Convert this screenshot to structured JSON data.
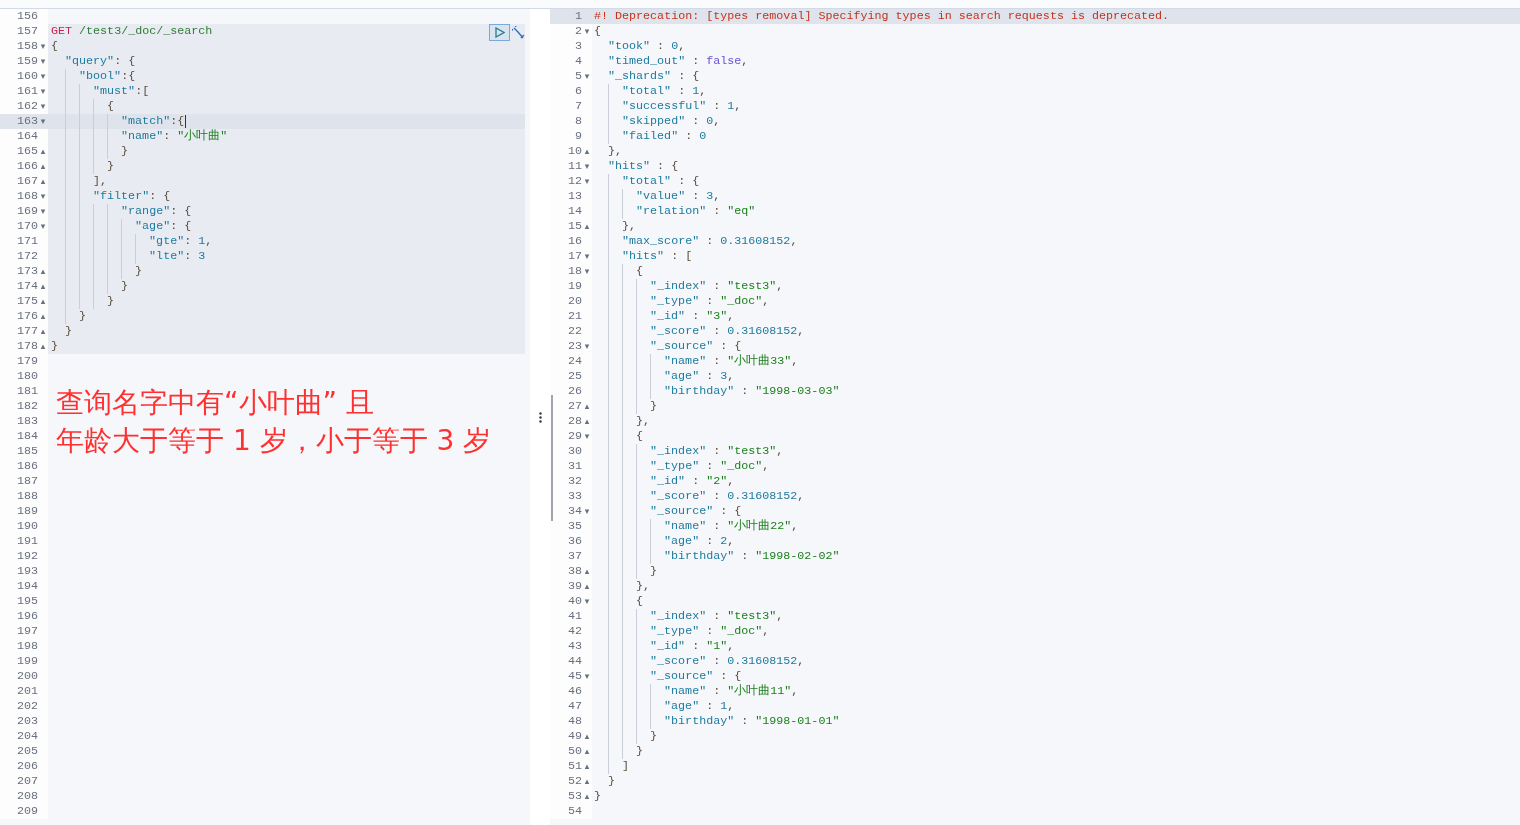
{
  "request_editor": {
    "lines_before": [
      {
        "number": "156",
        "current": false
      }
    ],
    "request": {
      "lines": [
        {
          "number": "157",
          "current": false,
          "tokens": [
            {
              "kind": "method",
              "text": "GET"
            },
            {
              "kind": "path",
              "text": " /test3/_doc/_search"
            }
          ]
        },
        {
          "number": "158",
          "fold": "▾",
          "current": false,
          "tokens": [
            {
              "kind": "punct",
              "text": "{"
            }
          ]
        },
        {
          "number": "159",
          "fold": "▾",
          "current": false,
          "tokens": [
            {
              "kind": "key",
              "text": "  \"query\""
            },
            {
              "kind": "punct",
              "text": ": {"
            }
          ]
        },
        {
          "number": "160",
          "fold": "▾",
          "current": false,
          "tokens": [
            {
              "kind": "key",
              "text": "    \"bool\""
            },
            {
              "kind": "punct",
              "text": ":{"
            }
          ]
        },
        {
          "number": "161",
          "fold": "▾",
          "current": false,
          "tokens": [
            {
              "kind": "key",
              "text": "      \"must\""
            },
            {
              "kind": "punct",
              "text": ":["
            }
          ]
        },
        {
          "number": "162",
          "fold": "▾",
          "current": false,
          "tokens": [
            {
              "kind": "punct",
              "text": "        {"
            }
          ]
        },
        {
          "number": "163",
          "fold": "▾",
          "current": true,
          "cursor": true,
          "tokens": [
            {
              "kind": "key",
              "text": "          \"match\""
            },
            {
              "kind": "punct",
              "text": ":{"
            }
          ]
        },
        {
          "number": "164",
          "current": false,
          "tokens": [
            {
              "kind": "key",
              "text": "          \"name\""
            },
            {
              "kind": "punct",
              "text": ": "
            },
            {
              "kind": "string",
              "text": "\"小叶曲\""
            }
          ]
        },
        {
          "number": "165",
          "fold": "▴",
          "current": false,
          "tokens": [
            {
              "kind": "punct",
              "text": "          }"
            }
          ]
        },
        {
          "number": "166",
          "fold": "▴",
          "current": false,
          "tokens": [
            {
              "kind": "punct",
              "text": "        }"
            }
          ]
        },
        {
          "number": "167",
          "fold": "▴",
          "current": false,
          "tokens": [
            {
              "kind": "punct",
              "text": "      ],"
            }
          ]
        },
        {
          "number": "168",
          "fold": "▾",
          "current": false,
          "tokens": [
            {
              "kind": "key",
              "text": "      \"filter\""
            },
            {
              "kind": "punct",
              "text": ": {"
            }
          ]
        },
        {
          "number": "169",
          "fold": "▾",
          "current": false,
          "tokens": [
            {
              "kind": "key",
              "text": "          \"range\""
            },
            {
              "kind": "punct",
              "text": ": {"
            }
          ]
        },
        {
          "number": "170",
          "fold": "▾",
          "current": false,
          "tokens": [
            {
              "kind": "key",
              "text": "            \"age\""
            },
            {
              "kind": "punct",
              "text": ": {"
            }
          ]
        },
        {
          "number": "171",
          "current": false,
          "tokens": [
            {
              "kind": "key",
              "text": "              \"gte\""
            },
            {
              "kind": "punct",
              "text": ": "
            },
            {
              "kind": "number",
              "text": "1"
            },
            {
              "kind": "punct",
              "text": ","
            }
          ]
        },
        {
          "number": "172",
          "current": false,
          "tokens": [
            {
              "kind": "key",
              "text": "              \"lte\""
            },
            {
              "kind": "punct",
              "text": ": "
            },
            {
              "kind": "number",
              "text": "3"
            }
          ]
        },
        {
          "number": "173",
          "fold": "▴",
          "current": false,
          "tokens": [
            {
              "kind": "punct",
              "text": "            }"
            }
          ]
        },
        {
          "number": "174",
          "fold": "▴",
          "current": false,
          "tokens": [
            {
              "kind": "punct",
              "text": "          }"
            }
          ]
        },
        {
          "number": "175",
          "fold": "▴",
          "current": false,
          "tokens": [
            {
              "kind": "punct",
              "text": "        }"
            }
          ]
        },
        {
          "number": "176",
          "fold": "▴",
          "current": false,
          "tokens": [
            {
              "kind": "punct",
              "text": "    }"
            }
          ]
        },
        {
          "number": "177",
          "fold": "▴",
          "current": false,
          "tokens": [
            {
              "kind": "punct",
              "text": "  }"
            }
          ]
        },
        {
          "number": "178",
          "fold": "▴",
          "current": false,
          "tokens": [
            {
              "kind": "punct",
              "text": "}"
            }
          ]
        }
      ]
    },
    "lines_after": [
      {
        "number": "179",
        "current": false
      },
      {
        "number": "180",
        "current": false
      },
      {
        "number": "181",
        "current": false
      },
      {
        "number": "182",
        "current": false
      },
      {
        "number": "183",
        "current": false
      },
      {
        "number": "184",
        "current": false
      },
      {
        "number": "185",
        "current": false
      },
      {
        "number": "186",
        "current": false
      },
      {
        "number": "187",
        "current": false
      },
      {
        "number": "188",
        "current": false
      },
      {
        "number": "189",
        "current": false
      },
      {
        "number": "190",
        "current": false
      },
      {
        "number": "191",
        "current": false
      },
      {
        "number": "192",
        "current": false
      },
      {
        "number": "193",
        "current": false
      },
      {
        "number": "194",
        "current": false
      },
      {
        "number": "195",
        "current": false
      },
      {
        "number": "196",
        "current": false
      },
      {
        "number": "197",
        "current": false
      },
      {
        "number": "198",
        "current": false
      },
      {
        "number": "199",
        "current": false
      },
      {
        "number": "200",
        "current": false
      },
      {
        "number": "201",
        "current": false
      },
      {
        "number": "202",
        "current": false
      },
      {
        "number": "203",
        "current": false
      },
      {
        "number": "204",
        "current": false
      },
      {
        "number": "205",
        "current": false
      },
      {
        "number": "206",
        "current": false
      },
      {
        "number": "207",
        "current": false
      },
      {
        "number": "208",
        "current": false
      },
      {
        "number": "209",
        "current": false
      }
    ],
    "annotation": [
      "查询名字中有“小叶曲” 且",
      "年龄大于等于 1 岁，小于等于 3 岁"
    ]
  },
  "response_editor": {
    "lines": [
      {
        "number": "1",
        "current": true,
        "tokens": [
          {
            "kind": "comment",
            "text": "#! Deprecation: [types removal] Specifying types in search requests is deprecated."
          }
        ]
      },
      {
        "number": "2",
        "fold": "▾",
        "current": false,
        "tokens": [
          {
            "kind": "punct",
            "text": "{"
          }
        ]
      },
      {
        "number": "3",
        "current": false,
        "tokens": [
          {
            "kind": "key",
            "text": "  \"took\""
          },
          {
            "kind": "punct",
            "text": " : "
          },
          {
            "kind": "number",
            "text": "0"
          },
          {
            "kind": "punct",
            "text": ","
          }
        ]
      },
      {
        "number": "4",
        "current": false,
        "tokens": [
          {
            "kind": "key",
            "text": "  \"timed_out\""
          },
          {
            "kind": "punct",
            "text": " : "
          },
          {
            "kind": "bool",
            "text": "false"
          },
          {
            "kind": "punct",
            "text": ","
          }
        ]
      },
      {
        "number": "5",
        "fold": "▾",
        "current": false,
        "tokens": [
          {
            "kind": "key",
            "text": "  \"_shards\""
          },
          {
            "kind": "punct",
            "text": " : {"
          }
        ]
      },
      {
        "number": "6",
        "current": false,
        "tokens": [
          {
            "kind": "key",
            "text": "    \"total\""
          },
          {
            "kind": "punct",
            "text": " : "
          },
          {
            "kind": "number",
            "text": "1"
          },
          {
            "kind": "punct",
            "text": ","
          }
        ]
      },
      {
        "number": "7",
        "current": false,
        "tokens": [
          {
            "kind": "key",
            "text": "    \"successful\""
          },
          {
            "kind": "punct",
            "text": " : "
          },
          {
            "kind": "number",
            "text": "1"
          },
          {
            "kind": "punct",
            "text": ","
          }
        ]
      },
      {
        "number": "8",
        "current": false,
        "tokens": [
          {
            "kind": "key",
            "text": "    \"skipped\""
          },
          {
            "kind": "punct",
            "text": " : "
          },
          {
            "kind": "number",
            "text": "0"
          },
          {
            "kind": "punct",
            "text": ","
          }
        ]
      },
      {
        "number": "9",
        "current": false,
        "tokens": [
          {
            "kind": "key",
            "text": "    \"failed\""
          },
          {
            "kind": "punct",
            "text": " : "
          },
          {
            "kind": "number",
            "text": "0"
          }
        ]
      },
      {
        "number": "10",
        "fold": "▴",
        "current": false,
        "tokens": [
          {
            "kind": "punct",
            "text": "  },"
          }
        ]
      },
      {
        "number": "11",
        "fold": "▾",
        "current": false,
        "tokens": [
          {
            "kind": "key",
            "text": "  \"hits\""
          },
          {
            "kind": "punct",
            "text": " : {"
          }
        ]
      },
      {
        "number": "12",
        "fold": "▾",
        "current": false,
        "tokens": [
          {
            "kind": "key",
            "text": "    \"total\""
          },
          {
            "kind": "punct",
            "text": " : {"
          }
        ]
      },
      {
        "number": "13",
        "current": false,
        "tokens": [
          {
            "kind": "key",
            "text": "      \"value\""
          },
          {
            "kind": "punct",
            "text": " : "
          },
          {
            "kind": "number",
            "text": "3"
          },
          {
            "kind": "punct",
            "text": ","
          }
        ]
      },
      {
        "number": "14",
        "current": false,
        "tokens": [
          {
            "kind": "key",
            "text": "      \"relation\""
          },
          {
            "kind": "punct",
            "text": " : "
          },
          {
            "kind": "string",
            "text": "\"eq\""
          }
        ]
      },
      {
        "number": "15",
        "fold": "▴",
        "current": false,
        "tokens": [
          {
            "kind": "punct",
            "text": "    },"
          }
        ]
      },
      {
        "number": "16",
        "current": false,
        "tokens": [
          {
            "kind": "key",
            "text": "    \"max_score\""
          },
          {
            "kind": "punct",
            "text": " : "
          },
          {
            "kind": "number",
            "text": "0.31608152"
          },
          {
            "kind": "punct",
            "text": ","
          }
        ]
      },
      {
        "number": "17",
        "fold": "▾",
        "current": false,
        "tokens": [
          {
            "kind": "key",
            "text": "    \"hits\""
          },
          {
            "kind": "punct",
            "text": " : ["
          }
        ]
      },
      {
        "number": "18",
        "fold": "▾",
        "current": false,
        "tokens": [
          {
            "kind": "punct",
            "text": "      {"
          }
        ]
      },
      {
        "number": "19",
        "current": false,
        "tokens": [
          {
            "kind": "key",
            "text": "        \"_index\""
          },
          {
            "kind": "punct",
            "text": " : "
          },
          {
            "kind": "string",
            "text": "\"test3\""
          },
          {
            "kind": "punct",
            "text": ","
          }
        ]
      },
      {
        "number": "20",
        "current": false,
        "tokens": [
          {
            "kind": "key",
            "text": "        \"_type\""
          },
          {
            "kind": "punct",
            "text": " : "
          },
          {
            "kind": "string",
            "text": "\"_doc\""
          },
          {
            "kind": "punct",
            "text": ","
          }
        ]
      },
      {
        "number": "21",
        "current": false,
        "tokens": [
          {
            "kind": "key",
            "text": "        \"_id\""
          },
          {
            "kind": "punct",
            "text": " : "
          },
          {
            "kind": "string",
            "text": "\"3\""
          },
          {
            "kind": "punct",
            "text": ","
          }
        ]
      },
      {
        "number": "22",
        "current": false,
        "tokens": [
          {
            "kind": "key",
            "text": "        \"_score\""
          },
          {
            "kind": "punct",
            "text": " : "
          },
          {
            "kind": "number",
            "text": "0.31608152"
          },
          {
            "kind": "punct",
            "text": ","
          }
        ]
      },
      {
        "number": "23",
        "fold": "▾",
        "current": false,
        "tokens": [
          {
            "kind": "key",
            "text": "        \"_source\""
          },
          {
            "kind": "punct",
            "text": " : {"
          }
        ]
      },
      {
        "number": "24",
        "current": false,
        "tokens": [
          {
            "kind": "key",
            "text": "          \"name\""
          },
          {
            "kind": "punct",
            "text": " : "
          },
          {
            "kind": "string",
            "text": "\"小叶曲33\""
          },
          {
            "kind": "punct",
            "text": ","
          }
        ]
      },
      {
        "number": "25",
        "current": false,
        "tokens": [
          {
            "kind": "key",
            "text": "          \"age\""
          },
          {
            "kind": "punct",
            "text": " : "
          },
          {
            "kind": "number",
            "text": "3"
          },
          {
            "kind": "punct",
            "text": ","
          }
        ]
      },
      {
        "number": "26",
        "current": false,
        "tokens": [
          {
            "kind": "key",
            "text": "          \"birthday\""
          },
          {
            "kind": "punct",
            "text": " : "
          },
          {
            "kind": "string",
            "text": "\"1998-03-03\""
          }
        ]
      },
      {
        "number": "27",
        "fold": "▴",
        "current": false,
        "tokens": [
          {
            "kind": "punct",
            "text": "        }"
          }
        ]
      },
      {
        "number": "28",
        "fold": "▴",
        "current": false,
        "tokens": [
          {
            "kind": "punct",
            "text": "      },"
          }
        ]
      },
      {
        "number": "29",
        "fold": "▾",
        "current": false,
        "tokens": [
          {
            "kind": "punct",
            "text": "      {"
          }
        ]
      },
      {
        "number": "30",
        "current": false,
        "tokens": [
          {
            "kind": "key",
            "text": "        \"_index\""
          },
          {
            "kind": "punct",
            "text": " : "
          },
          {
            "kind": "string",
            "text": "\"test3\""
          },
          {
            "kind": "punct",
            "text": ","
          }
        ]
      },
      {
        "number": "31",
        "current": false,
        "tokens": [
          {
            "kind": "key",
            "text": "        \"_type\""
          },
          {
            "kind": "punct",
            "text": " : "
          },
          {
            "kind": "string",
            "text": "\"_doc\""
          },
          {
            "kind": "punct",
            "text": ","
          }
        ]
      },
      {
        "number": "32",
        "current": false,
        "tokens": [
          {
            "kind": "key",
            "text": "        \"_id\""
          },
          {
            "kind": "punct",
            "text": " : "
          },
          {
            "kind": "string",
            "text": "\"2\""
          },
          {
            "kind": "punct",
            "text": ","
          }
        ]
      },
      {
        "number": "33",
        "current": false,
        "tokens": [
          {
            "kind": "key",
            "text": "        \"_score\""
          },
          {
            "kind": "punct",
            "text": " : "
          },
          {
            "kind": "number",
            "text": "0.31608152"
          },
          {
            "kind": "punct",
            "text": ","
          }
        ]
      },
      {
        "number": "34",
        "fold": "▾",
        "current": false,
        "tokens": [
          {
            "kind": "key",
            "text": "        \"_source\""
          },
          {
            "kind": "punct",
            "text": " : {"
          }
        ]
      },
      {
        "number": "35",
        "current": false,
        "tokens": [
          {
            "kind": "key",
            "text": "          \"name\""
          },
          {
            "kind": "punct",
            "text": " : "
          },
          {
            "kind": "string",
            "text": "\"小叶曲22\""
          },
          {
            "kind": "punct",
            "text": ","
          }
        ]
      },
      {
        "number": "36",
        "current": false,
        "tokens": [
          {
            "kind": "key",
            "text": "          \"age\""
          },
          {
            "kind": "punct",
            "text": " : "
          },
          {
            "kind": "number",
            "text": "2"
          },
          {
            "kind": "punct",
            "text": ","
          }
        ]
      },
      {
        "number": "37",
        "current": false,
        "tokens": [
          {
            "kind": "key",
            "text": "          \"birthday\""
          },
          {
            "kind": "punct",
            "text": " : "
          },
          {
            "kind": "string",
            "text": "\"1998-02-02\""
          }
        ]
      },
      {
        "number": "38",
        "fold": "▴",
        "current": false,
        "tokens": [
          {
            "kind": "punct",
            "text": "        }"
          }
        ]
      },
      {
        "number": "39",
        "fold": "▴",
        "current": false,
        "tokens": [
          {
            "kind": "punct",
            "text": "      },"
          }
        ]
      },
      {
        "number": "40",
        "fold": "▾",
        "current": false,
        "tokens": [
          {
            "kind": "punct",
            "text": "      {"
          }
        ]
      },
      {
        "number": "41",
        "current": false,
        "tokens": [
          {
            "kind": "key",
            "text": "        \"_index\""
          },
          {
            "kind": "punct",
            "text": " : "
          },
          {
            "kind": "string",
            "text": "\"test3\""
          },
          {
            "kind": "punct",
            "text": ","
          }
        ]
      },
      {
        "number": "42",
        "current": false,
        "tokens": [
          {
            "kind": "key",
            "text": "        \"_type\""
          },
          {
            "kind": "punct",
            "text": " : "
          },
          {
            "kind": "string",
            "text": "\"_doc\""
          },
          {
            "kind": "punct",
            "text": ","
          }
        ]
      },
      {
        "number": "43",
        "current": false,
        "tokens": [
          {
            "kind": "key",
            "text": "        \"_id\""
          },
          {
            "kind": "punct",
            "text": " : "
          },
          {
            "kind": "string",
            "text": "\"1\""
          },
          {
            "kind": "punct",
            "text": ","
          }
        ]
      },
      {
        "number": "44",
        "current": false,
        "tokens": [
          {
            "kind": "key",
            "text": "        \"_score\""
          },
          {
            "kind": "punct",
            "text": " : "
          },
          {
            "kind": "number",
            "text": "0.31608152"
          },
          {
            "kind": "punct",
            "text": ","
          }
        ]
      },
      {
        "number": "45",
        "fold": "▾",
        "current": false,
        "tokens": [
          {
            "kind": "key",
            "text": "        \"_source\""
          },
          {
            "kind": "punct",
            "text": " : {"
          }
        ]
      },
      {
        "number": "46",
        "current": false,
        "tokens": [
          {
            "kind": "key",
            "text": "          \"name\""
          },
          {
            "kind": "punct",
            "text": " : "
          },
          {
            "kind": "string",
            "text": "\"小叶曲11\""
          },
          {
            "kind": "punct",
            "text": ","
          }
        ]
      },
      {
        "number": "47",
        "current": false,
        "tokens": [
          {
            "kind": "key",
            "text": "          \"age\""
          },
          {
            "kind": "punct",
            "text": " : "
          },
          {
            "kind": "number",
            "text": "1"
          },
          {
            "kind": "punct",
            "text": ","
          }
        ]
      },
      {
        "number": "48",
        "current": false,
        "tokens": [
          {
            "kind": "key",
            "text": "          \"birthday\""
          },
          {
            "kind": "punct",
            "text": " : "
          },
          {
            "kind": "string",
            "text": "\"1998-01-01\""
          }
        ]
      },
      {
        "number": "49",
        "fold": "▴",
        "current": false,
        "tokens": [
          {
            "kind": "punct",
            "text": "        }"
          }
        ]
      },
      {
        "number": "50",
        "fold": "▴",
        "current": false,
        "tokens": [
          {
            "kind": "punct",
            "text": "      }"
          }
        ]
      },
      {
        "number": "51",
        "fold": "▴",
        "current": false,
        "tokens": [
          {
            "kind": "punct",
            "text": "    ]"
          }
        ]
      },
      {
        "number": "52",
        "fold": "▴",
        "current": false,
        "tokens": [
          {
            "kind": "punct",
            "text": "  }"
          }
        ]
      },
      {
        "number": "53",
        "fold": "▴",
        "current": false,
        "tokens": [
          {
            "kind": "punct",
            "text": "}"
          }
        ]
      },
      {
        "number": "54",
        "current": false
      }
    ]
  }
}
